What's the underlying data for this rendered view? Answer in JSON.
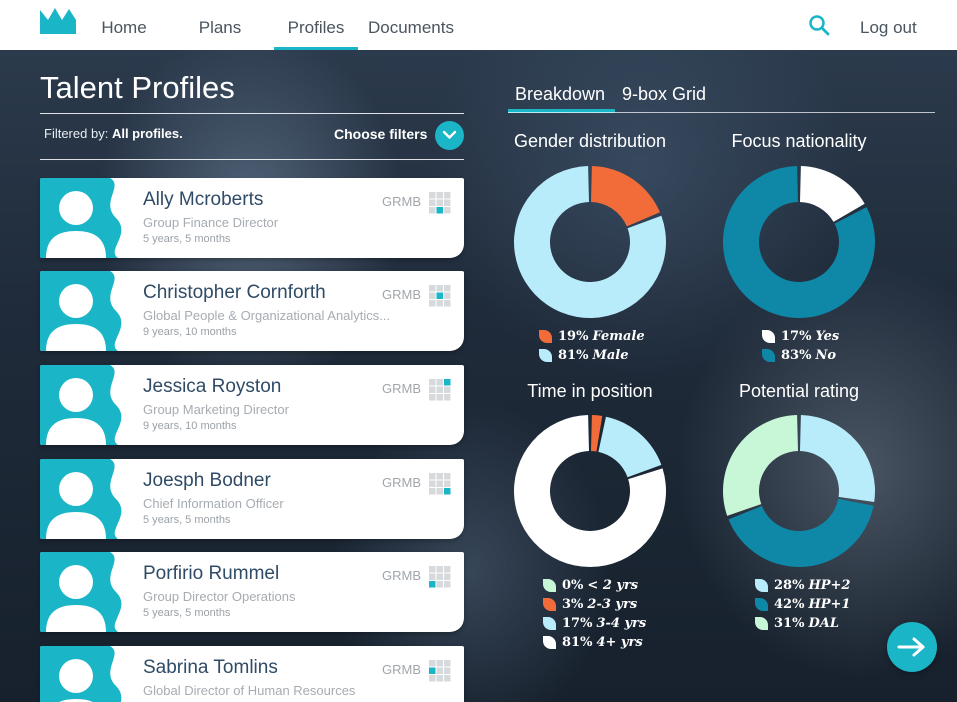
{
  "nav": {
    "items": [
      "Home",
      "Plans",
      "Profiles",
      "Documents"
    ],
    "active": "Profiles",
    "logout": "Log out"
  },
  "page": {
    "title": "Talent Profiles",
    "filtered_by_label": "Filtered by:",
    "filtered_by_value": "All profiles.",
    "choose_filters": "Choose filters"
  },
  "profiles": [
    {
      "name": "Ally Mcroberts",
      "role": "Group Finance Director",
      "tenure": "5 years, 5 months",
      "code": "GRMB",
      "grid_cell": 8
    },
    {
      "name": "Christopher Cornforth",
      "role": "Global People & Organizational Analytics...",
      "tenure": "9 years, 10 months",
      "code": "GRMB",
      "grid_cell": 5
    },
    {
      "name": "Jessica Royston",
      "role": "Group Marketing Director",
      "tenure": "9 years, 10 months",
      "code": "GRMB",
      "grid_cell": 3
    },
    {
      "name": "Joesph Bodner",
      "role": "Chief Information Officer",
      "tenure": "5 years, 5 months",
      "code": "GRMB",
      "grid_cell": 9
    },
    {
      "name": "Porfirio Rummel",
      "role": "Group Director Operations",
      "tenure": "5 years, 5 months",
      "code": "GRMB",
      "grid_cell": 7
    },
    {
      "name": "Sabrina Tomlins",
      "role": "Global Director of Human Resources",
      "tenure": "",
      "code": "GRMB",
      "grid_cell": 4
    }
  ],
  "tabs": [
    "Breakdown",
    "9-box Grid"
  ],
  "active_tab": "Breakdown",
  "colors": {
    "accent": "#1ab5c6",
    "orange": "#f26c3a",
    "light_blue": "#b9ecfa",
    "dark_teal": "#0f87a7",
    "white": "#ffffff",
    "mint": "#c8f7d8"
  },
  "chart_data": [
    {
      "type": "pie",
      "title": "Gender distribution",
      "series": [
        {
          "name": "Female",
          "value": 19,
          "label": "19%",
          "color": "#f26c3a"
        },
        {
          "name": "Male",
          "value": 81,
          "label": "81%",
          "color": "#b9ecfa"
        }
      ]
    },
    {
      "type": "pie",
      "title": "Focus nationality",
      "series": [
        {
          "name": "Yes",
          "value": 17,
          "label": "17%",
          "color": "#ffffff"
        },
        {
          "name": "No",
          "value": 83,
          "label": "83%",
          "color": "#0f87a7"
        }
      ]
    },
    {
      "type": "pie",
      "title": "Time in position",
      "series": [
        {
          "name": "< 2 yrs",
          "value": 0,
          "label": "0%",
          "color": "#c8f7d8"
        },
        {
          "name": "2-3 yrs",
          "value": 3,
          "label": "3%",
          "color": "#f26c3a"
        },
        {
          "name": "3-4 yrs",
          "value": 17,
          "label": "17%",
          "color": "#b9ecfa"
        },
        {
          "name": "4+ yrs",
          "value": 81,
          "label": "81%",
          "color": "#ffffff"
        }
      ]
    },
    {
      "type": "pie",
      "title": "Potential rating",
      "series": [
        {
          "name": "HP+2",
          "value": 28,
          "label": "28%",
          "color": "#b9ecfa"
        },
        {
          "name": "HP+1",
          "value": 42,
          "label": "42%",
          "color": "#0f87a7"
        },
        {
          "name": "DAL",
          "value": 31,
          "label": "31%",
          "color": "#c8f7d8"
        }
      ]
    }
  ]
}
